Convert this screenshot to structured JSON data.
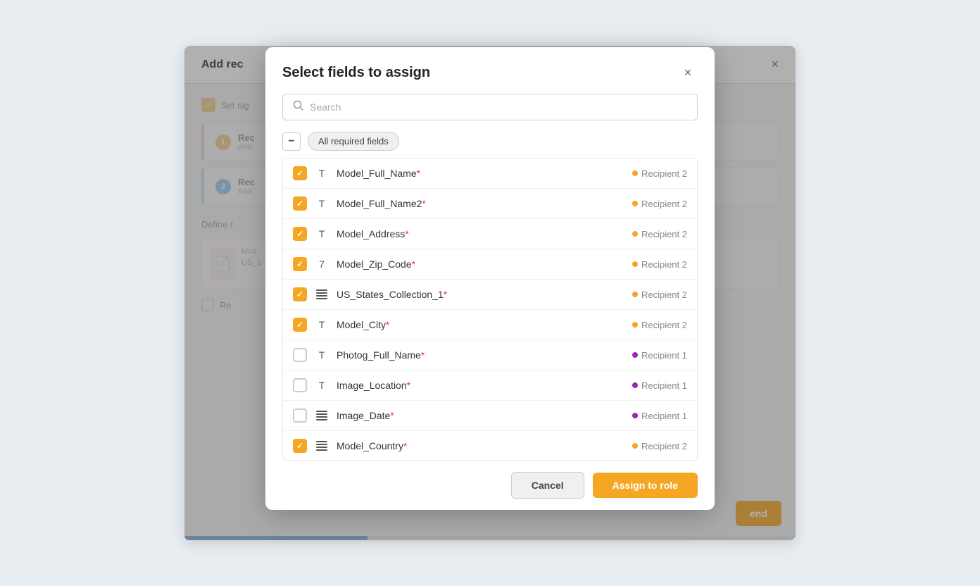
{
  "background": {
    "title": "Add rec",
    "close_label": "×"
  },
  "modal": {
    "title": "Select fields to assign",
    "close_label": "×",
    "search_placeholder": "Search",
    "filter_label": "All required fields",
    "fields": [
      {
        "id": "f1",
        "name": "Model_Full_Name",
        "required": true,
        "type": "text",
        "type_icon": "T",
        "recipient": "Recipient 2",
        "recipient_num": 2,
        "checked": true
      },
      {
        "id": "f2",
        "name": "Model_Full_Name2",
        "required": true,
        "type": "text",
        "type_icon": "T",
        "recipient": "Recipient 2",
        "recipient_num": 2,
        "checked": true
      },
      {
        "id": "f3",
        "name": "Model_Address",
        "required": true,
        "type": "text",
        "type_icon": "T",
        "recipient": "Recipient 2",
        "recipient_num": 2,
        "checked": true
      },
      {
        "id": "f4",
        "name": "Model_Zip_Code",
        "required": true,
        "type": "number",
        "type_icon": "7",
        "recipient": "Recipient 2",
        "recipient_num": 2,
        "checked": true
      },
      {
        "id": "f5",
        "name": "US_States_Collection_1",
        "required": true,
        "type": "list",
        "type_icon": "☰",
        "recipient": "Recipient 2",
        "recipient_num": 2,
        "checked": true
      },
      {
        "id": "f6",
        "name": "Model_City",
        "required": true,
        "type": "text",
        "type_icon": "T",
        "recipient": "Recipient 2",
        "recipient_num": 2,
        "checked": true
      },
      {
        "id": "f7",
        "name": "Photog_Full_Name",
        "required": true,
        "type": "text",
        "type_icon": "T",
        "recipient": "Recipient 1",
        "recipient_num": 1,
        "checked": false
      },
      {
        "id": "f8",
        "name": "Image_Location",
        "required": true,
        "type": "text",
        "type_icon": "T",
        "recipient": "Recipient 1",
        "recipient_num": 1,
        "checked": false
      },
      {
        "id": "f9",
        "name": "Image_Date",
        "required": true,
        "type": "date",
        "type_icon": "☰",
        "recipient": "Recipient 1",
        "recipient_num": 1,
        "checked": false
      },
      {
        "id": "f10",
        "name": "Model_Country",
        "required": true,
        "type": "list",
        "type_icon": "☰",
        "recipient": "Recipient 2",
        "recipient_num": 2,
        "checked": true
      }
    ],
    "cancel_label": "Cancel",
    "assign_label": "Assign to role"
  }
}
